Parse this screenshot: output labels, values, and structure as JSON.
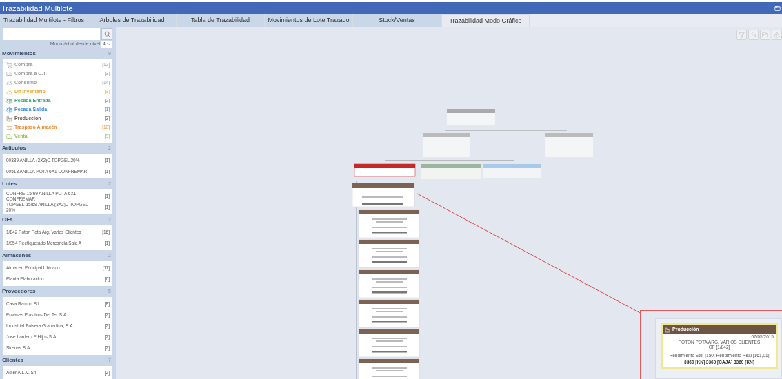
{
  "window": {
    "title": "Trazabilidad Multilote"
  },
  "tabs": [
    {
      "label": "Trazabilidad Multilote - Filtros",
      "selected": false
    },
    {
      "label": "Arboles de Trazabilidad",
      "selected": false
    },
    {
      "label": "Tabla de Trazabilidad",
      "selected": false
    },
    {
      "label": "Movimientos de Lote Trazado",
      "selected": false
    },
    {
      "label": "Stock/Ventas",
      "selected": false
    },
    {
      "label": "Trazabilidad Modo Gráfico",
      "selected": true
    }
  ],
  "sidebar": {
    "tree_mode": {
      "label": "Modo árbol desde nivel",
      "value": "4"
    },
    "sections": [
      {
        "title": "Movimientos",
        "count": "9",
        "kind": "movements",
        "items": [
          {
            "label": "Compra",
            "count": "[12]",
            "color": "#9a9a9a"
          },
          {
            "label": "Compra a C.T.",
            "count": "[3]",
            "color": "#9a9a9a"
          },
          {
            "label": "Consumo",
            "count": "[14]",
            "color": "#9a9a9a"
          },
          {
            "label": "Dif Inventario",
            "count": "[3]",
            "color": "#f0a830"
          },
          {
            "label": "Pesada Entrada",
            "count": "[2]",
            "color": "#3aa876"
          },
          {
            "label": "Pesada Salida",
            "count": "[1]",
            "color": "#3b8ad9"
          },
          {
            "label": "Producción",
            "count": "[3]",
            "color": "#6b5a48"
          },
          {
            "label": "Traspaso Almacén",
            "count": "[10]",
            "color": "#f08a30"
          },
          {
            "label": "Venta",
            "count": "[9]",
            "color": "#8bc34a"
          }
        ]
      },
      {
        "title": "Articulos",
        "count": "2",
        "kind": "list",
        "items": [
          {
            "label": "00389 ANILLA (3X2)C TOPGEL 20%",
            "count": "[1]"
          },
          {
            "label": "00518 ANILLA POTA 6X1 CONFREMAR",
            "count": "[1]"
          }
        ]
      },
      {
        "title": "Lotes",
        "count": "2",
        "kind": "list",
        "items": [
          {
            "label": "CONFRE-15/69 ANILLA POTA 6X1 CONFREMAR",
            "count": "[1]"
          },
          {
            "label": "TOPGEL-15/69 ANILLA (3X2)C TOPGEL 20%",
            "count": "[1]"
          }
        ]
      },
      {
        "title": "OFs",
        "count": "2",
        "kind": "list",
        "items": [
          {
            "label": "1/842 Poton Pota Arg. Varios Clientes",
            "count": "[16]"
          },
          {
            "label": "1/954 Reetiquetado Mercancia Sala A",
            "count": "[1]"
          }
        ]
      },
      {
        "title": "Almacenes",
        "count": "2",
        "kind": "list",
        "items": [
          {
            "label": "Almacen Principal Ubicado",
            "count": "[11]"
          },
          {
            "label": "Planta Elaboracion",
            "count": "[6]"
          }
        ]
      },
      {
        "title": "Proveedores",
        "count": "5",
        "kind": "list",
        "items": [
          {
            "label": "Casa Ramon S.L.",
            "count": "[8]"
          },
          {
            "label": "Envases Plasticos Del Ter S.A.",
            "count": "[2]"
          },
          {
            "label": "Industrial Bolsera Granadina, S.A.",
            "count": "[2]"
          },
          {
            "label": "Jose Lantero E Hijos S.A.",
            "count": "[2]"
          },
          {
            "label": "Sirenas S.A.",
            "count": "[2]"
          }
        ]
      },
      {
        "title": "Clientes",
        "count": "7",
        "kind": "list",
        "items": [
          {
            "label": "Adler A.L.V. Srl",
            "count": "[2]"
          }
        ]
      }
    ]
  },
  "zoom_card": {
    "title": "Producción",
    "date": "07/05/2015",
    "product": "POTON POTA ARG. VARIOS CLIENTES",
    "order": "OF [1/842]",
    "yield": "Rendimiento Std. [150] Rendimiento Real [161,01]",
    "quantities": "3360 [KN] 3360 [CAJA] 3360 [KN]"
  }
}
